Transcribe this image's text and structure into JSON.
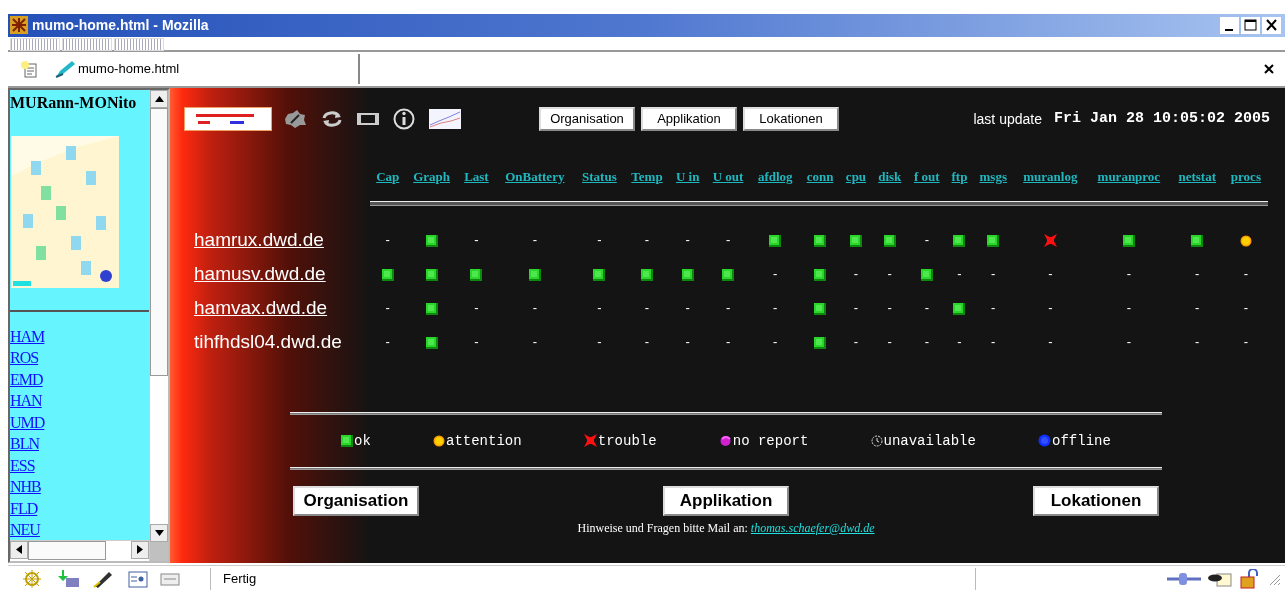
{
  "window": {
    "title": "mumo-home.html - Mozilla"
  },
  "tab": {
    "label": "mumo-home.html"
  },
  "sidebar": {
    "title": "MURann-MONito",
    "links": [
      "HAM",
      "ROS",
      "EMD",
      "HAN",
      "UMD",
      "BLN",
      "ESS",
      "NHB",
      "FLD",
      "NEU"
    ]
  },
  "page": {
    "nav_buttons": [
      "Organisation",
      "Applikation",
      "Lokationen"
    ],
    "last_update_label": "last update",
    "last_update": "Fri Jan 28 10:05:02 2005",
    "columns": [
      "Cap",
      "Graph",
      "Last",
      "OnBattery",
      "Status",
      "Temp",
      "U in",
      "U out",
      "afdlog",
      "conn",
      "cpu",
      "disk",
      "f out",
      "ftp",
      "msgs",
      "muranlog",
      "muranproc",
      "netstat",
      "procs"
    ],
    "hosts": [
      {
        "name": "hamrux.dwd.de",
        "link": true,
        "cells": [
          {
            "kind": "none",
            "text": "-"
          },
          {
            "kind": "ok"
          },
          {
            "kind": "none",
            "text": "-"
          },
          {
            "kind": "none",
            "text": "-"
          },
          {
            "kind": "none",
            "text": "-"
          },
          {
            "kind": "none",
            "text": "-"
          },
          {
            "kind": "none",
            "text": "-"
          },
          {
            "kind": "none",
            "text": "-"
          },
          {
            "kind": "ok"
          },
          {
            "kind": "ok"
          },
          {
            "kind": "ok"
          },
          {
            "kind": "ok"
          },
          {
            "kind": "none",
            "text": "-"
          },
          {
            "kind": "ok"
          },
          {
            "kind": "ok"
          },
          {
            "kind": "trouble"
          },
          {
            "kind": "ok"
          },
          {
            "kind": "ok"
          },
          {
            "kind": "attention"
          }
        ]
      },
      {
        "name": "hamusv.dwd.de",
        "link": true,
        "cells": [
          {
            "kind": "ok"
          },
          {
            "kind": "ok"
          },
          {
            "kind": "ok"
          },
          {
            "kind": "ok"
          },
          {
            "kind": "ok"
          },
          {
            "kind": "ok"
          },
          {
            "kind": "ok"
          },
          {
            "kind": "ok"
          },
          {
            "kind": "none",
            "text": "-"
          },
          {
            "kind": "ok"
          },
          {
            "kind": "none",
            "text": "-"
          },
          {
            "kind": "none",
            "text": "-"
          },
          {
            "kind": "ok"
          },
          {
            "kind": "none",
            "text": "-"
          },
          {
            "kind": "none",
            "text": "-"
          },
          {
            "kind": "none",
            "text": "-"
          },
          {
            "kind": "none",
            "text": "-"
          },
          {
            "kind": "none",
            "text": "-"
          },
          {
            "kind": "none",
            "text": "-"
          }
        ]
      },
      {
        "name": "hamvax.dwd.de",
        "link": true,
        "cells": [
          {
            "kind": "none",
            "text": "-"
          },
          {
            "kind": "ok"
          },
          {
            "kind": "none",
            "text": "-"
          },
          {
            "kind": "none",
            "text": "-"
          },
          {
            "kind": "none",
            "text": "-"
          },
          {
            "kind": "none",
            "text": "-"
          },
          {
            "kind": "none",
            "text": "-"
          },
          {
            "kind": "none",
            "text": "-"
          },
          {
            "kind": "none",
            "text": "-"
          },
          {
            "kind": "ok"
          },
          {
            "kind": "none",
            "text": "-"
          },
          {
            "kind": "none",
            "text": "-"
          },
          {
            "kind": "none",
            "text": "-"
          },
          {
            "kind": "ok"
          },
          {
            "kind": "none",
            "text": "-"
          },
          {
            "kind": "none",
            "text": "-"
          },
          {
            "kind": "none",
            "text": "-"
          },
          {
            "kind": "none",
            "text": "-"
          },
          {
            "kind": "none",
            "text": "-"
          }
        ]
      },
      {
        "name": "tihfhdsl04.dwd.de",
        "link": false,
        "cells": [
          {
            "kind": "none",
            "text": "-"
          },
          {
            "kind": "ok"
          },
          {
            "kind": "none",
            "text": "-"
          },
          {
            "kind": "none",
            "text": "-"
          },
          {
            "kind": "none",
            "text": "-"
          },
          {
            "kind": "none",
            "text": "-"
          },
          {
            "kind": "none",
            "text": "-"
          },
          {
            "kind": "none",
            "text": "-"
          },
          {
            "kind": "none",
            "text": "-"
          },
          {
            "kind": "ok"
          },
          {
            "kind": "none",
            "text": "-"
          },
          {
            "kind": "none",
            "text": "-"
          },
          {
            "kind": "none",
            "text": "-"
          },
          {
            "kind": "none",
            "text": "-"
          },
          {
            "kind": "none",
            "text": "-"
          },
          {
            "kind": "none",
            "text": "-"
          },
          {
            "kind": "none",
            "text": "-"
          },
          {
            "kind": "none",
            "text": "-"
          },
          {
            "kind": "none",
            "text": "-"
          }
        ]
      }
    ],
    "legend": [
      {
        "kind": "ok",
        "label": "ok"
      },
      {
        "kind": "attention",
        "label": "attention"
      },
      {
        "kind": "trouble",
        "label": "trouble"
      },
      {
        "kind": "noreport",
        "label": "no report"
      },
      {
        "kind": "unavailable",
        "label": "unavailable"
      },
      {
        "kind": "offline",
        "label": "offline"
      }
    ],
    "footer_buttons": [
      "Organisation",
      "Applikation",
      "Lokationen"
    ],
    "footer_note": "Hinweise und Fragen bitte Mail an:",
    "footer_email": "thomas.schaefer@dwd.de"
  },
  "status_bar": {
    "text": "Fertig"
  }
}
